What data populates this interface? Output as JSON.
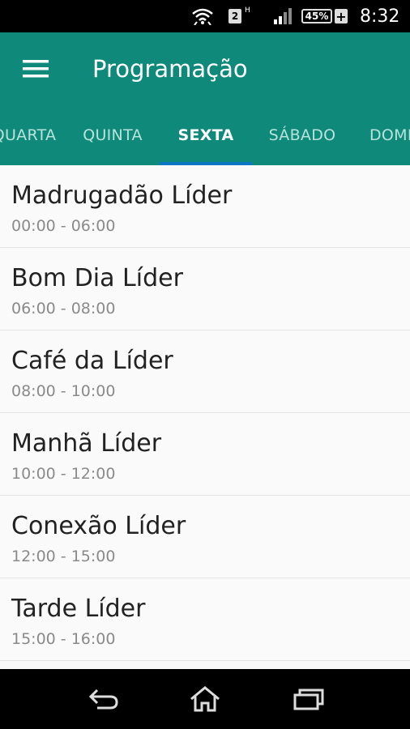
{
  "status_bar": {
    "sim_number": "2",
    "network_type": "H",
    "battery_percent": "45%",
    "charging_symbol": "+",
    "time": "8:32",
    "icons": [
      "wifi-icon",
      "sim-icon",
      "signal-icon",
      "battery-icon"
    ]
  },
  "app_bar": {
    "title": "Programação",
    "menu_icon": "hamburger-menu-icon"
  },
  "tabs": [
    {
      "label": "QUARTA",
      "active": false
    },
    {
      "label": "QUINTA",
      "active": false
    },
    {
      "label": "SEXTA",
      "active": true
    },
    {
      "label": "SÁBADO",
      "active": false
    },
    {
      "label": "DOMINGO",
      "active": false
    }
  ],
  "programs": [
    {
      "title": "Madrugadão Líder",
      "time": "00:00 - 06:00"
    },
    {
      "title": "Bom Dia Líder",
      "time": "06:00 - 08:00"
    },
    {
      "title": "Café da Líder",
      "time": "08:00 - 10:00"
    },
    {
      "title": "Manhã Líder",
      "time": "10:00 - 12:00"
    },
    {
      "title": "Conexão Líder",
      "time": "12:00 - 15:00"
    },
    {
      "title": "Tarde Líder",
      "time": "15:00 - 16:00"
    }
  ],
  "nav_bar": {
    "icons": [
      "back-icon",
      "home-icon",
      "recent-apps-icon"
    ]
  },
  "colors": {
    "primary": "#0f8a7a",
    "tab_indicator": "#0d76c4",
    "tab_inactive_text": "#b7e3dc",
    "title_text": "#222222",
    "time_text": "#8a8a8a"
  }
}
